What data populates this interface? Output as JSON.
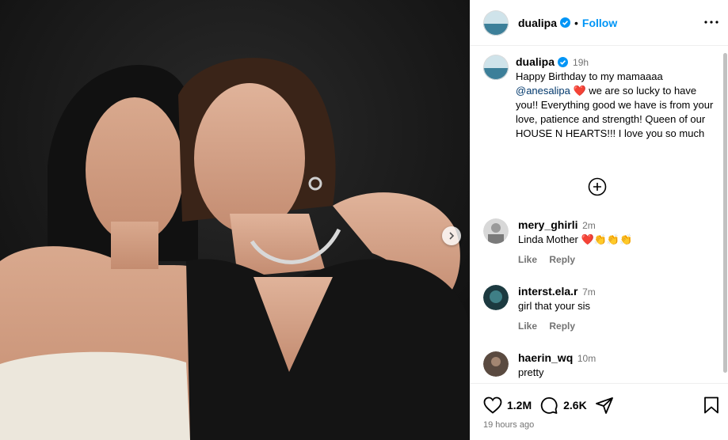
{
  "post": {
    "username": "dualipa",
    "follow_label": "Follow",
    "separator": "•",
    "caption_time": "19h",
    "caption_line1": "Happy Birthday to my mamaaaa",
    "mention": "@anesalipa",
    "heart": "❤️",
    "caption_rest": " we are so lucky to have you!! Everything good we have is from your love, patience and strength! Queen of our HOUSE N HEARTS!!! I love you so much",
    "likes": "1.2M",
    "comments_count": "2.6K",
    "posted_time": "19 hours ago"
  },
  "comments": [
    {
      "username": "mery_ghirli",
      "time": "2m",
      "text": "Linda Mother ",
      "emoji": "❤️👏👏👏",
      "like_label": "Like",
      "reply_label": "Reply"
    },
    {
      "username": "interst.ela.r",
      "time": "7m",
      "text": "girl that your sis",
      "like_label": "Like",
      "reply_label": "Reply"
    },
    {
      "username": "haerin_wq",
      "time": "10m",
      "text": "pretty"
    }
  ],
  "icons": [
    "verified-badge-icon",
    "more-options-icon",
    "add-comment-icon",
    "heart-icon",
    "comment-icon",
    "share-icon",
    "bookmark-icon",
    "chevron-right-icon"
  ],
  "colors": {
    "follow": "#0095f6",
    "verified": "#0095f6",
    "heart": "#ed4956",
    "meta": "#737373"
  }
}
